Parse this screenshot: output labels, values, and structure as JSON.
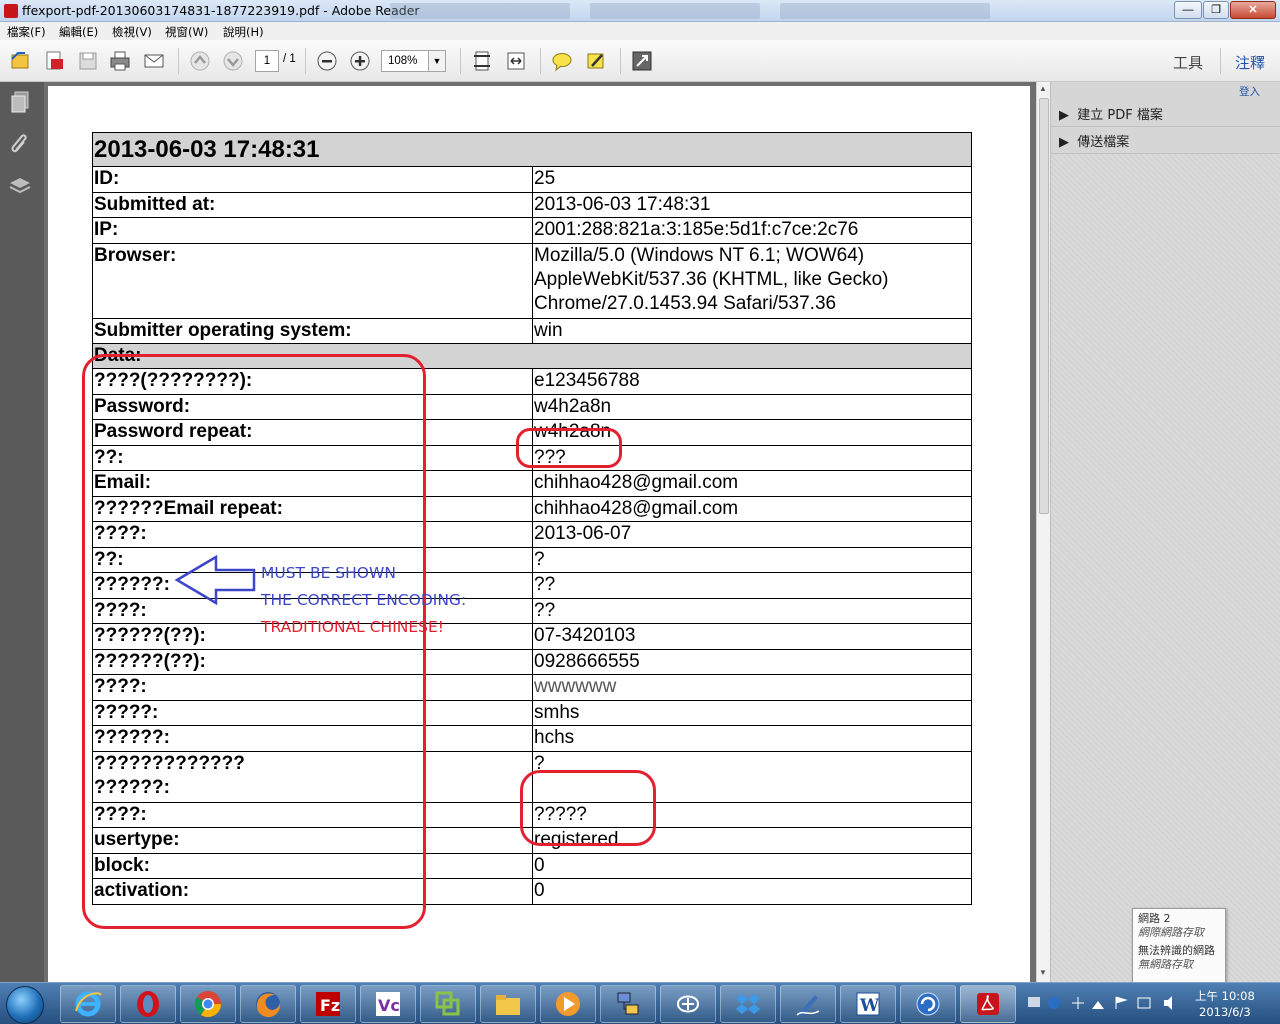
{
  "window": {
    "title": "ffexport-pdf-20130603174831-1877223919.pdf - Adobe Reader",
    "accent": "#2354a8"
  },
  "menu": [
    "檔案(F)",
    "編輯(E)",
    "檢視(V)",
    "視窗(W)",
    "說明(H)"
  ],
  "toolbar": {
    "page_current": "1",
    "page_total": "/ 1",
    "zoom": "108%",
    "tools_label": "工具",
    "comment_label": "注釋"
  },
  "right_pane": {
    "login": "登入",
    "create_pdf": "建立 PDF 檔案",
    "send_files": "傳送檔案"
  },
  "document": {
    "header": "2013-06-03 17:48:31",
    "fields": [
      {
        "key": "ID:",
        "value": "25"
      },
      {
        "key": "Submitted at:",
        "value": "2013-06-03 17:48:31"
      },
      {
        "key": "IP:",
        "value": "2001:288:821a:3:185e:5d1f:c7ce:2c76"
      },
      {
        "key": "Browser:",
        "value": "Mozilla/5.0 (Windows NT 6.1; WOW64) AppleWebKit/537.36 (KHTML, like Gecko) Chrome/27.0.1453.94 Safari/537.36"
      },
      {
        "key": "Submitter operating system:",
        "value": "win"
      }
    ],
    "section_label": "Data:",
    "data_rows": [
      {
        "key": "????(????????):",
        "value": "e123456788"
      },
      {
        "key": "Password:",
        "value": "w4h2a8n"
      },
      {
        "key": "Password repeat:",
        "value": "w4h2a8n"
      },
      {
        "key": "??:",
        "value": "???"
      },
      {
        "key": "Email:",
        "value": "chihhao428@gmail.com"
      },
      {
        "key": "??????Email repeat:",
        "value": "chihhao428@gmail.com"
      },
      {
        "key": "????:",
        "value": "2013-06-07"
      },
      {
        "key": "??:",
        "value": "?"
      },
      {
        "key": "??????:",
        "value": "??"
      },
      {
        "key": "????:",
        "value": "??"
      },
      {
        "key": "??????(??):",
        "value": "07-3420103"
      },
      {
        "key": "??????(??):",
        "value": "0928666555"
      },
      {
        "key": "????:",
        "value": "wwwwww"
      },
      {
        "key": "?????:",
        "value": "smhs"
      },
      {
        "key": "??????:",
        "value": "hchs"
      },
      {
        "key": "????????????? ??????:",
        "value": "?"
      },
      {
        "key": "????:",
        "value": "?????"
      },
      {
        "key": "usertype:",
        "value": "registered"
      },
      {
        "key": "block:",
        "value": "0"
      },
      {
        "key": "activation:",
        "value": "0"
      }
    ]
  },
  "annotations": {
    "line1": "MUST BE SHOWN",
    "line2": "THE CORRECT  ENCODING:",
    "line3": "TRADITIONAL CHINESE!",
    "red": "#e3202f",
    "blue": "#3b46c9"
  },
  "network_popup": {
    "line1": "網路  2",
    "line2": "網際網路存取",
    "line3": "無法辨識的網路",
    "line4": "無網路存取"
  },
  "taskbar": {
    "time": "上午 10:08",
    "date": "2013/6/3"
  }
}
